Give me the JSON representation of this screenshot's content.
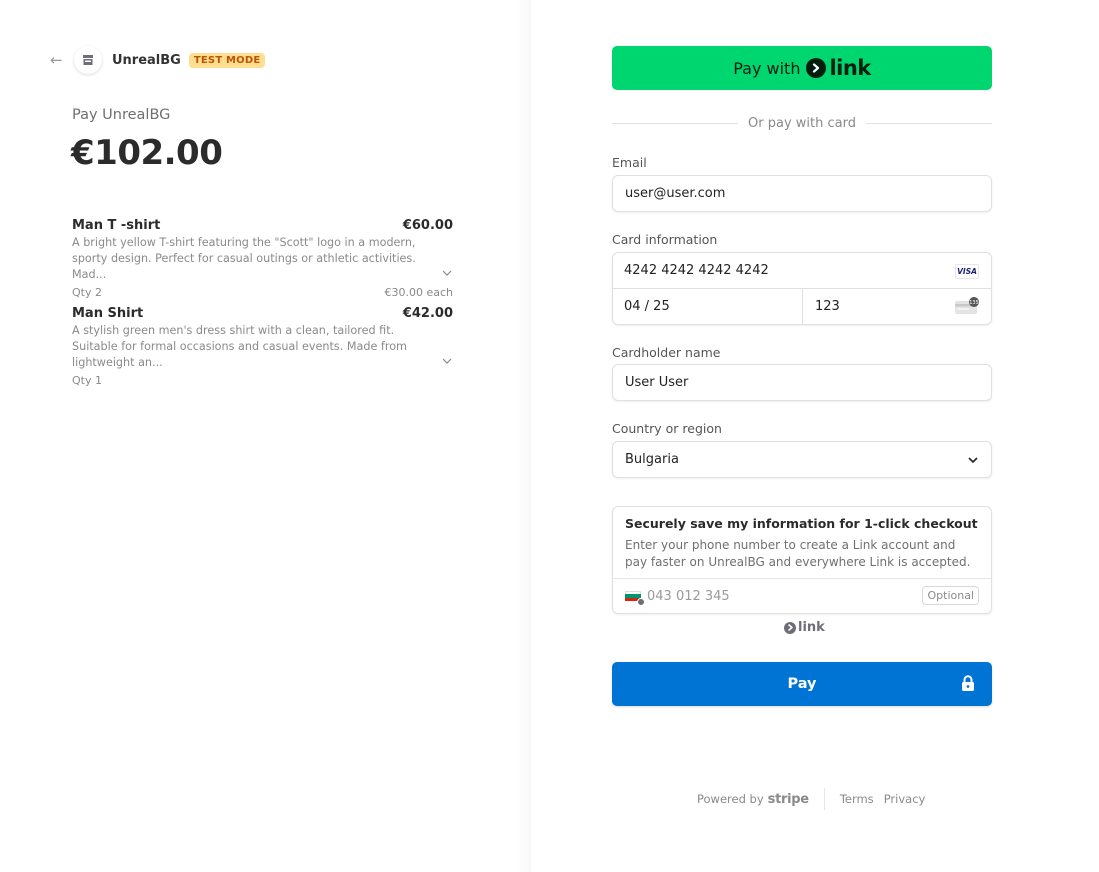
{
  "header": {
    "merchant_name": "UnrealBG",
    "badge": "TEST MODE",
    "back_icon": "arrow-left-icon",
    "logo_icon": "store-icon"
  },
  "summary": {
    "pay_label": "Pay UnrealBG",
    "total": "€102.00"
  },
  "line_items": [
    {
      "name": "Man T -shirt",
      "price": "€60.00",
      "description": "A bright yellow T-shirt featuring the \"Scott\" logo in a modern, sporty design. Perfect for casual outings or athletic activities. Mad...",
      "qty": "Qty 2",
      "unit_price": "€30.00 each"
    },
    {
      "name": "Man Shirt",
      "price": "€42.00",
      "description": "A stylish green men's dress shirt with a clean, tailored fit. Suitable for formal occasions and casual events. Made from lightweight an...",
      "qty": "Qty 1",
      "unit_price": ""
    }
  ],
  "payment": {
    "link_button": {
      "prefix": "Pay with",
      "brand": "link"
    },
    "divider_text": "Or pay with card",
    "email": {
      "label": "Email",
      "value": "user@user.com"
    },
    "card": {
      "label": "Card information",
      "number": "4242 4242 4242 4242",
      "brand": "VISA",
      "expiry": "04 / 25",
      "cvc": "123"
    },
    "cardholder": {
      "label": "Cardholder name",
      "value": "User User"
    },
    "country": {
      "label": "Country or region",
      "value": "Bulgaria"
    },
    "save_info": {
      "title": "Securely save my information for 1-click checkout",
      "description": "Enter your phone number to create a Link account and pay faster on UnrealBG and everywhere Link is accepted.",
      "phone_placeholder": "043 012 345",
      "optional_label": "Optional"
    },
    "link_small": "link",
    "pay_button": "Pay"
  },
  "footer": {
    "powered_by": "Powered by",
    "stripe": "stripe",
    "terms": "Terms",
    "privacy": "Privacy"
  },
  "colors": {
    "link_green": "#00d66f",
    "pay_blue": "#0074d4",
    "badge_bg": "#ffde92",
    "badge_text": "#bb5504"
  }
}
